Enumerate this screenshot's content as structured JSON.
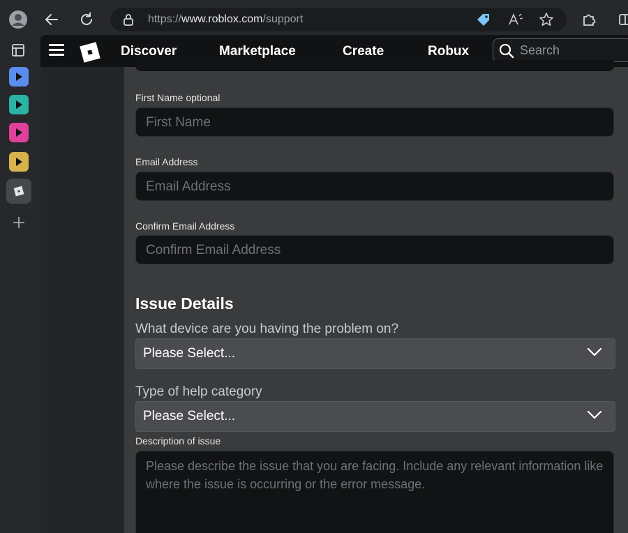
{
  "browser": {
    "url_prefix": "https://",
    "url_host": "www.roblox.com",
    "url_path": "/support",
    "vertical_tab_colors": [
      "#5b8def",
      "#2bb3a4",
      "#e0409a",
      "#d8b24a"
    ]
  },
  "nav": {
    "links": [
      "Discover",
      "Marketplace",
      "Create",
      "Robux"
    ],
    "search_placeholder": "Search"
  },
  "form": {
    "first_name": {
      "label": "First Name optional",
      "placeholder": "First Name"
    },
    "email": {
      "label": "Email Address",
      "placeholder": "Email Address"
    },
    "confirm_email": {
      "label": "Confirm Email Address",
      "placeholder": "Confirm Email Address"
    },
    "issue_title": "Issue Details",
    "device": {
      "question": "What device are you having the problem on?",
      "selected": "Please Select..."
    },
    "category": {
      "question": "Type of help category",
      "selected": "Please Select..."
    },
    "description": {
      "label": "Description of issue",
      "placeholder": "Please describe the issue that you are facing. Include any relevant information like where the issue is occurring or the error message."
    }
  }
}
